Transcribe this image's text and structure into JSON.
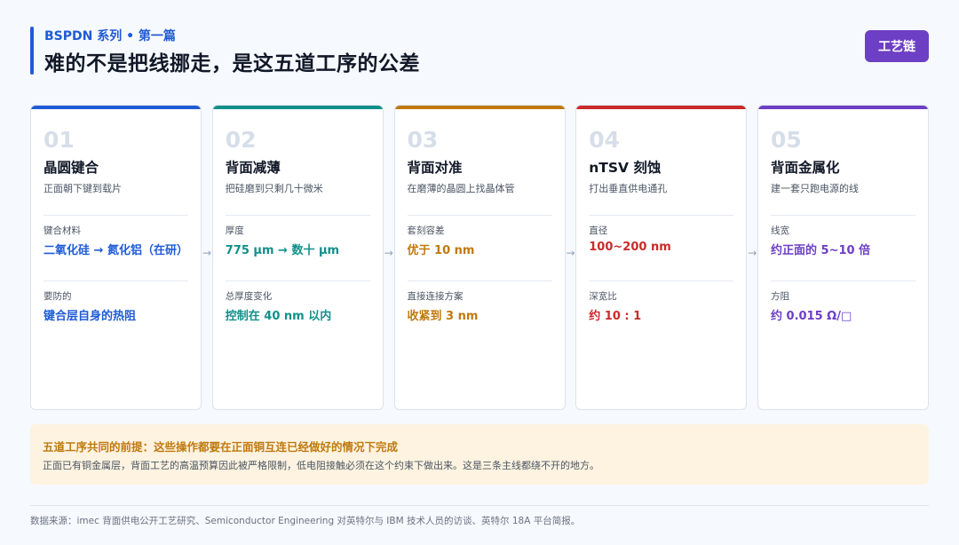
{
  "header": {
    "series": "BSPDN 系列 • 第一篇",
    "title": "难的不是把线挪走，是这五道工序的公差",
    "tag": "工艺链"
  },
  "steps": [
    {
      "num": "01",
      "name": "晶圆键合",
      "desc": "正面朝下键到载片",
      "label1": "键合材料",
      "value1": "二氧化硅 → 氮化铝（在研）",
      "label2": "要防的",
      "value2": "键合层自身的热阻",
      "color": "#1f5bd6"
    },
    {
      "num": "02",
      "name": "背面减薄",
      "desc": "把硅磨到只剩几十微米",
      "label1": "厚度",
      "value1": "775 µm → 数十 µm",
      "label2": "总厚度变化",
      "value2": "控制在 40 nm 以内",
      "color": "#11908a"
    },
    {
      "num": "03",
      "name": "背面对准",
      "desc": "在磨薄的晶圆上找晶体管",
      "label1": "套刻容差",
      "value1": "优于 10 nm",
      "label2": "直接连接方案",
      "value2": "收紧到 3 nm",
      "color": "#c0790f"
    },
    {
      "num": "04",
      "name": "nTSV 刻蚀",
      "desc": "打出垂直供电通孔",
      "label1": "直径",
      "value1": "100~200 nm",
      "label2": "深宽比",
      "value2": "约 10 : 1",
      "color": "#c92a2a"
    },
    {
      "num": "05",
      "name": "背面金属化",
      "desc": "建一套只跑电源的线",
      "label1": "线宽",
      "value1": "约正面的 5~10 倍",
      "label2": "方阻",
      "value2": "约 0.015 Ω/□",
      "color": "#6d3fc4"
    }
  ],
  "note": {
    "title": "五道工序共同的前提：这些操作都要在正面铜互连已经做好的情况下完成",
    "text": "正面已有铜金属层，背面工艺的高温预算因此被严格限制，低电阻接触必须在这个约束下做出来。这是三条主线都绕不开的地方。"
  },
  "footer": {
    "source": "数据来源：imec 背面供电公开工艺研究、Semiconductor Engineering 对英特尔与 IBM 技术人员的访谈、英特尔 18A 平台简报。"
  },
  "colors": {
    "accent": "#1f5bd6",
    "tag": "#6d3fc4",
    "note_bg": "#fdf3e0",
    "note_title": "#c0790f"
  }
}
